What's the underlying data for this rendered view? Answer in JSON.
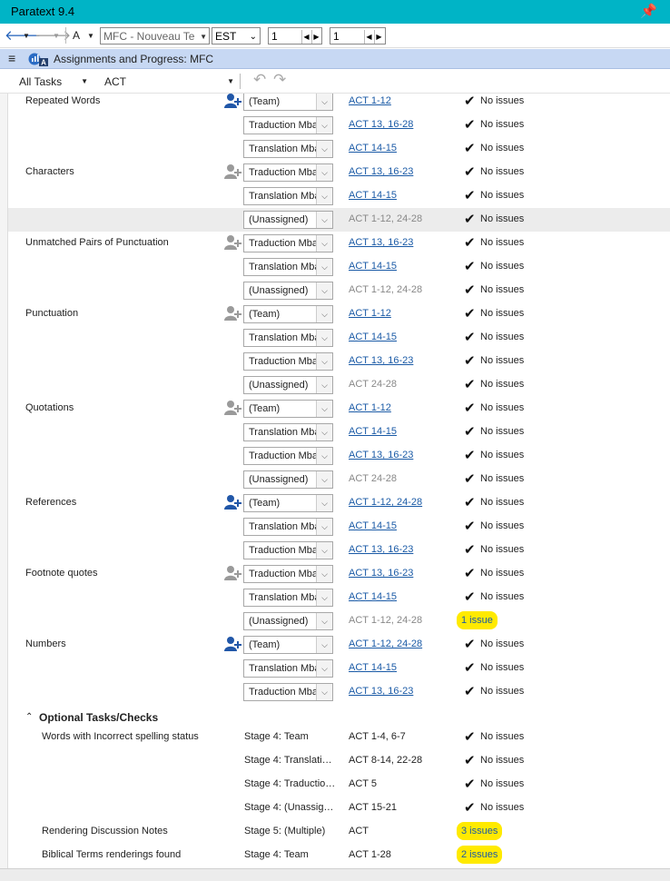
{
  "app": {
    "title": "Paratext 9.4"
  },
  "toolbar": {
    "text_style": "A",
    "project": "MFC - Nouveau Te",
    "versification": "EST",
    "chapter": "1",
    "verse": "1"
  },
  "panel": {
    "title": "Assignments and Progress: MFC"
  },
  "filter": {
    "tasks": "All Tasks",
    "book": "ACT"
  },
  "colors": {
    "title_bar": "#00b4c6",
    "panel_header": "#c7d8f3",
    "link": "#1a5aa6",
    "highlight": "#ffea00"
  },
  "rows": [
    {
      "check": "Repeated Words",
      "person": "blue",
      "assignee": "(Team)",
      "range": "ACT 1-12",
      "range_style": "link",
      "status": "No issues"
    },
    {
      "check": "",
      "person": "",
      "assignee": "Traduction Mba",
      "range": "ACT 13, 16-28",
      "range_style": "link",
      "status": "No issues"
    },
    {
      "check": "",
      "person": "",
      "assignee": "Translation Mba",
      "range": "ACT 14-15",
      "range_style": "link",
      "status": "No issues"
    },
    {
      "check": "Characters",
      "person": "gray",
      "assignee": "Traduction Mba",
      "range": "ACT 13, 16-23",
      "range_style": "link",
      "status": "No issues"
    },
    {
      "check": "",
      "person": "",
      "assignee": "Translation Mba",
      "range": "ACT 14-15",
      "range_style": "link",
      "status": "No issues"
    },
    {
      "check": "",
      "person": "",
      "assignee": "(Unassigned)",
      "range": "ACT 1-12, 24-28",
      "range_style": "gray",
      "status": "No issues",
      "shaded": true
    },
    {
      "check": "Unmatched Pairs of Punctuation",
      "person": "gray",
      "assignee": "Traduction Mba",
      "range": "ACT 13, 16-23",
      "range_style": "link",
      "status": "No issues"
    },
    {
      "check": "",
      "person": "",
      "assignee": "Translation Mba",
      "range": "ACT 14-15",
      "range_style": "link",
      "status": "No issues"
    },
    {
      "check": "",
      "person": "",
      "assignee": "(Unassigned)",
      "range": "ACT 1-12, 24-28",
      "range_style": "gray",
      "status": "No issues"
    },
    {
      "check": "Punctuation",
      "person": "gray",
      "assignee": "(Team)",
      "range": "ACT 1-12",
      "range_style": "link",
      "status": "No issues"
    },
    {
      "check": "",
      "person": "",
      "assignee": "Translation Mba",
      "range": "ACT 14-15",
      "range_style": "link",
      "status": "No issues"
    },
    {
      "check": "",
      "person": "",
      "assignee": "Traduction Mba",
      "range": "ACT 13, 16-23",
      "range_style": "link",
      "status": "No issues"
    },
    {
      "check": "",
      "person": "",
      "assignee": "(Unassigned)",
      "range": "ACT 24-28",
      "range_style": "gray",
      "status": "No issues"
    },
    {
      "check": "Quotations",
      "person": "gray",
      "assignee": "(Team)",
      "range": "ACT 1-12",
      "range_style": "link",
      "status": "No issues"
    },
    {
      "check": "",
      "person": "",
      "assignee": "Translation Mba",
      "range": "ACT 14-15",
      "range_style": "link",
      "status": "No issues"
    },
    {
      "check": "",
      "person": "",
      "assignee": "Traduction Mba",
      "range": "ACT 13, 16-23",
      "range_style": "link",
      "status": "No issues"
    },
    {
      "check": "",
      "person": "",
      "assignee": "(Unassigned)",
      "range": "ACT 24-28",
      "range_style": "gray",
      "status": "No issues"
    },
    {
      "check": "References",
      "person": "blue",
      "assignee": "(Team)",
      "range": "ACT 1-12, 24-28",
      "range_style": "link",
      "status": "No issues"
    },
    {
      "check": "",
      "person": "",
      "assignee": "Translation Mba",
      "range": "ACT 14-15",
      "range_style": "link",
      "status": "No issues"
    },
    {
      "check": "",
      "person": "",
      "assignee": "Traduction Mba",
      "range": "ACT 13, 16-23",
      "range_style": "link",
      "status": "No issues"
    },
    {
      "check": "Footnote quotes",
      "person": "gray",
      "assignee": "Traduction Mba",
      "range": "ACT 13, 16-23",
      "range_style": "link",
      "status": "No issues"
    },
    {
      "check": "",
      "person": "",
      "assignee": "Translation Mba",
      "range": "ACT 14-15",
      "range_style": "link",
      "status": "No issues"
    },
    {
      "check": "",
      "person": "",
      "assignee": "(Unassigned)",
      "range": "ACT 1-12, 24-28",
      "range_style": "gray",
      "status": "1 issue",
      "issue": true
    },
    {
      "check": "Numbers",
      "person": "blue",
      "assignee": "(Team)",
      "range": "ACT 1-12, 24-28",
      "range_style": "link",
      "status": "No issues"
    },
    {
      "check": "",
      "person": "",
      "assignee": "Translation Mba",
      "range": "ACT 14-15",
      "range_style": "link",
      "status": "No issues"
    },
    {
      "check": "",
      "person": "",
      "assignee": "Traduction Mba",
      "range": "ACT 13, 16-23",
      "range_style": "link",
      "status": "No issues"
    }
  ],
  "optional": {
    "title": "Optional Tasks/Checks",
    "rows": [
      {
        "check": "Words with Incorrect spelling status",
        "stage": "Stage 4: Team",
        "range": "ACT 1-4, 6-7",
        "status": "No issues"
      },
      {
        "check": "",
        "stage": "Stage 4: Translati…",
        "range": "ACT 8-14, 22-28",
        "status": "No issues"
      },
      {
        "check": "",
        "stage": "Stage 4: Traductio…",
        "range": "ACT 5",
        "status": "No issues"
      },
      {
        "check": "",
        "stage": "Stage 4: (Unassig…",
        "range": "ACT 15-21",
        "status": "No issues"
      },
      {
        "check": "Rendering Discussion Notes",
        "stage": "Stage 5: (Multiple)",
        "range": "ACT",
        "status": "3 issues",
        "issue": true
      },
      {
        "check": "Biblical Terms renderings found",
        "stage": "Stage 4: Team",
        "range": "ACT 1-28",
        "status": "2 issues",
        "issue": true
      }
    ]
  }
}
